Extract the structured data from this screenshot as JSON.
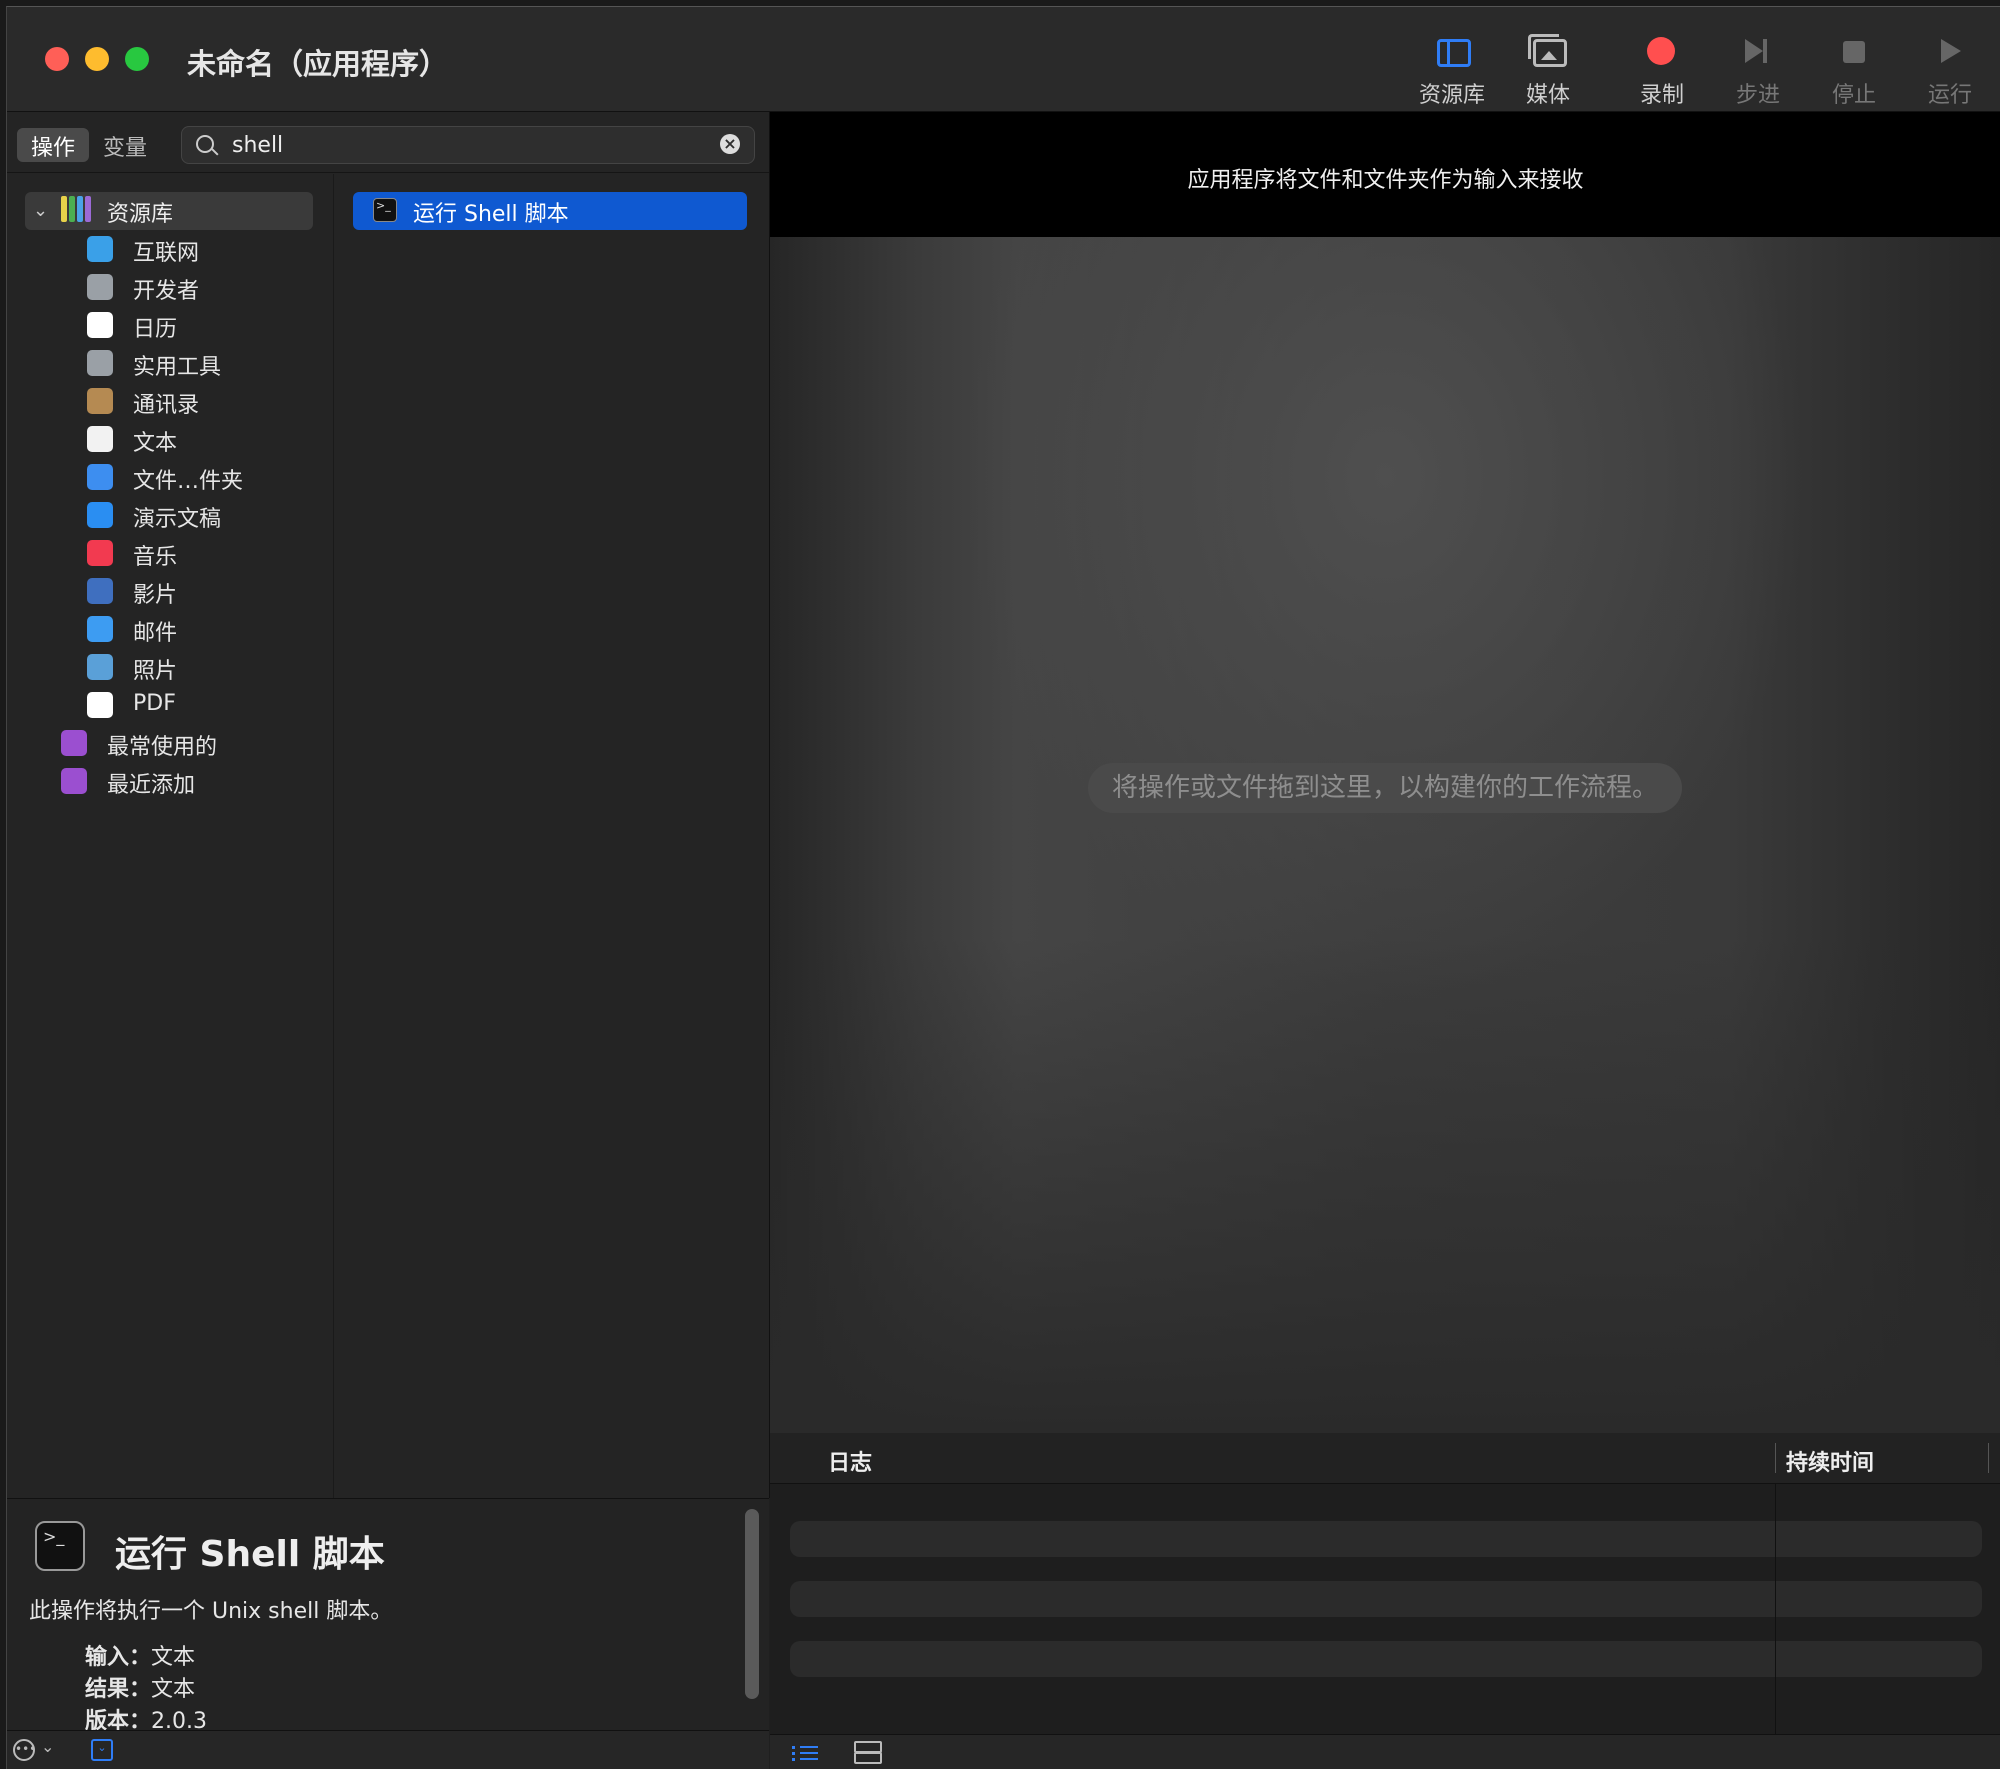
{
  "window": {
    "title": "未命名（应用程序）"
  },
  "toolbar": {
    "library": "资源库",
    "media": "媒体",
    "record": "录制",
    "step": "步进",
    "stop": "停止",
    "run": "运行"
  },
  "sidebar": {
    "tabs": [
      "操作",
      "变量"
    ],
    "search": {
      "value": "shell",
      "placeholder": ""
    },
    "library": "资源库",
    "categories": [
      {
        "label": "互联网",
        "icon": "globe-icon",
        "color": "#3aa0e8"
      },
      {
        "label": "开发者",
        "icon": "tools-icon",
        "color": "#9aa0a6"
      },
      {
        "label": "日历",
        "icon": "calendar-icon",
        "color": "#ffffff"
      },
      {
        "label": "实用工具",
        "icon": "utilities-icon",
        "color": "#9aa0a6"
      },
      {
        "label": "通讯录",
        "icon": "contacts-icon",
        "color": "#b58a52"
      },
      {
        "label": "文本",
        "icon": "text-icon",
        "color": "#f2f2f2"
      },
      {
        "label": "文件…件夹",
        "icon": "finder-icon",
        "color": "#3d8ef0"
      },
      {
        "label": "演示文稿",
        "icon": "keynote-icon",
        "color": "#2a8ef2"
      },
      {
        "label": "音乐",
        "icon": "music-icon",
        "color": "#f23a50"
      },
      {
        "label": "影片",
        "icon": "quicktime-icon",
        "color": "#3f6fbf"
      },
      {
        "label": "邮件",
        "icon": "mail-icon",
        "color": "#3d9cf2"
      },
      {
        "label": "照片",
        "icon": "photos-icon",
        "color": "#5aa0d8"
      },
      {
        "label": "PDF",
        "icon": "pdf-icon",
        "color": "#ffffff"
      }
    ],
    "smart_groups": [
      {
        "label": "最常使用的",
        "icon": "smart-folder-icon",
        "color": "#9b4fd0"
      },
      {
        "label": "最近添加",
        "icon": "smart-folder-icon",
        "color": "#9b4fd0"
      }
    ]
  },
  "actions": [
    {
      "label": "运行 Shell 脚本",
      "selected": true
    }
  ],
  "description": {
    "title": "运行 Shell 脚本",
    "text": "此操作将执行一个 Unix shell 脚本。",
    "input_label": "输入：",
    "input_value": "文本",
    "result_label": "结果：",
    "result_value": "文本",
    "version_label": "版本：",
    "version_value": "2.0.3"
  },
  "workflow": {
    "banner": "应用程序将文件和文件夹作为输入来接收",
    "hint": "将操作或文件拖到这里，以构建你的工作流程。"
  },
  "log": {
    "col_log": "日志",
    "col_duration": "持续时间"
  },
  "colors": {
    "accent": "#0f59d1",
    "record": "#ff4f4f",
    "toolbar_icon_active": "#2f7df6"
  }
}
